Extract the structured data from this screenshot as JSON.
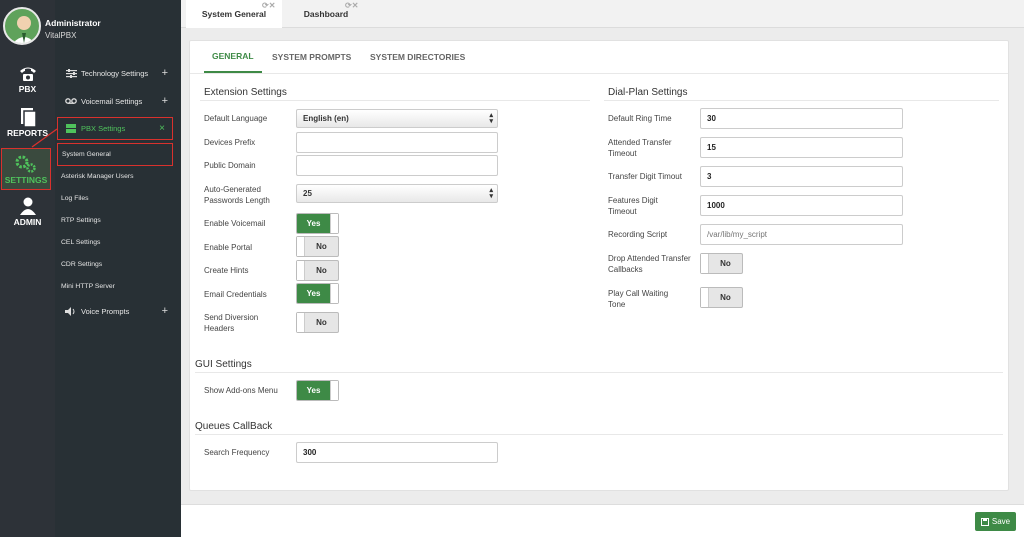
{
  "user": {
    "name": "Administrator",
    "org": "VitalPBX"
  },
  "rail": [
    {
      "label": "PBX",
      "icon": "phone-icon"
    },
    {
      "label": "REPORTS",
      "icon": "document-icon"
    },
    {
      "label": "SETTINGS",
      "icon": "gears-icon"
    },
    {
      "label": "ADMIN",
      "icon": "user-icon"
    }
  ],
  "menu": {
    "technology": "Technology Settings",
    "voicemail": "Voicemail Settings",
    "pbx": "PBX Settings",
    "close": "×",
    "voice_prompts": "Voice Prompts",
    "plus": "+"
  },
  "submenu": [
    "System General",
    "Asterisk Manager Users",
    "Log Files",
    "RTP Settings",
    "CEL Settings",
    "CDR Settings",
    "Mini HTTP Server"
  ],
  "tabs": [
    "System General",
    "Dashboard"
  ],
  "subtabs": [
    "GENERAL",
    "SYSTEM PROMPTS",
    "SYSTEM DIRECTORIES"
  ],
  "ext": {
    "title": "Extension Settings",
    "default_language_label": "Default Language",
    "default_language": "English (en)",
    "devices_prefix_label": "Devices Prefix",
    "devices_prefix": "",
    "public_domain_label": "Public Domain",
    "public_domain": "",
    "autogen_label": "Auto-Generated Passwords Length",
    "autogen": "25",
    "enable_voicemail_label": "Enable Voicemail",
    "enable_voicemail": "Yes",
    "enable_portal_label": "Enable Portal",
    "enable_portal": "No",
    "create_hints_label": "Create Hints",
    "create_hints": "No",
    "email_credentials_label": "Email Credentials",
    "email_credentials": "Yes",
    "send_diversion_label": "Send Diversion Headers",
    "send_diversion": "No"
  },
  "dial": {
    "title": "Dial-Plan Settings",
    "ring_time_label": "Default Ring Time",
    "ring_time": "30",
    "att_timeout_label": "Attended Transfer Timeout",
    "att_timeout": "15",
    "digit_timeout_label": "Transfer Digit Timout",
    "digit_timeout": "3",
    "features_label": "Features Digit Timeout",
    "features": "1000",
    "rec_script_label": "Recording Script",
    "rec_script_placeholder": "/var/lib/my_script",
    "drop_label": "Drop Attended Transfer Callbacks",
    "drop": "No",
    "play_label": "Play Call Waiting Tone",
    "play": "No"
  },
  "gui": {
    "title": "GUI Settings",
    "addons_label": "Show Add-ons Menu",
    "addons": "Yes"
  },
  "queues": {
    "title": "Queues CallBack",
    "freq_label": "Search Frequency",
    "freq": "300"
  },
  "save_label": "Save",
  "colors": {
    "accent": "#3e8a46",
    "highlight": "#d9312d",
    "sidebar": "#283035"
  }
}
